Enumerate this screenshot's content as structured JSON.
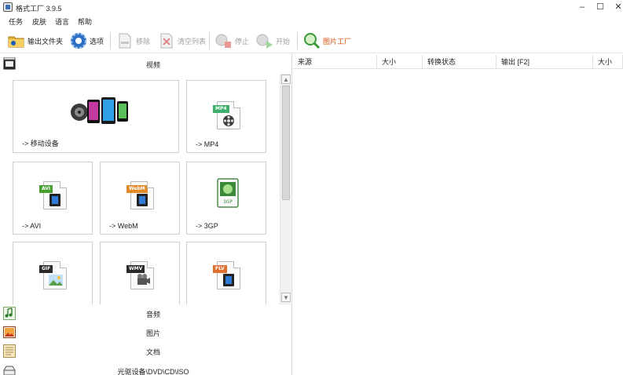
{
  "window": {
    "title": "格式工厂 3.9.5",
    "min": "–",
    "max": "☐",
    "close": "✕"
  },
  "menu": [
    "任务",
    "皮肤",
    "语言",
    "帮助"
  ],
  "toolbar": {
    "output_folder": "输出文件夹",
    "options": "选项",
    "remove": "移除",
    "clear_list": "清空列表",
    "stop": "停止",
    "start": "开始",
    "picture_factory": "图片工厂"
  },
  "categories": {
    "video": "视频",
    "audio": "音频",
    "picture": "图片",
    "document": "文档",
    "rom": "光驱设备\\DVD\\CD\\ISO"
  },
  "tiles": [
    {
      "label": "-> 移动设备"
    },
    {
      "label": "-> MP4",
      "badge": "MP4",
      "color": "#3fae6c"
    },
    {
      "label": "-> AVI",
      "badge": "AVI",
      "color": "#4a9d2f"
    },
    {
      "label": "-> WebM",
      "badge": "WebM",
      "color": "#e08a2a"
    },
    {
      "label": "-> 3GP",
      "badge": "3GP",
      "color": "#3a8a3a"
    },
    {
      "label": "",
      "badge": "GIF",
      "color": "#2a2a2a"
    },
    {
      "label": "",
      "badge": "WMV",
      "color": "#2a2a2a"
    },
    {
      "label": "",
      "badge": "FLV",
      "color": "#e07030"
    }
  ],
  "columns": [
    "来源",
    "大小",
    "转换状态",
    "输出 [F2]",
    "大小"
  ],
  "scroll_arrows": {
    "up": "▲",
    "down": "▼"
  }
}
